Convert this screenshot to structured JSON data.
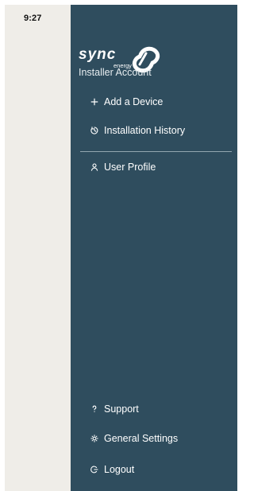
{
  "status_bar": {
    "time": "9:27"
  },
  "brand": {
    "name": "sync",
    "sub": "energy",
    "account_label": "Installer Account"
  },
  "menu": {
    "primary": [
      {
        "label": "Add a Device",
        "icon": "plus-icon"
      },
      {
        "label": "Installation History",
        "icon": "history-icon"
      }
    ],
    "secondary": [
      {
        "label": "User Profile",
        "icon": "user-icon"
      }
    ],
    "footer": [
      {
        "label": "Support",
        "icon": "question-icon"
      },
      {
        "label": "General Settings",
        "icon": "gear-icon"
      },
      {
        "label": "Logout",
        "icon": "logout-icon"
      }
    ]
  },
  "colors": {
    "sidebar_bg": "#2f4d5e",
    "left_bg": "#efede8",
    "text": "#ffffff",
    "divider": "#9fb0b8"
  }
}
